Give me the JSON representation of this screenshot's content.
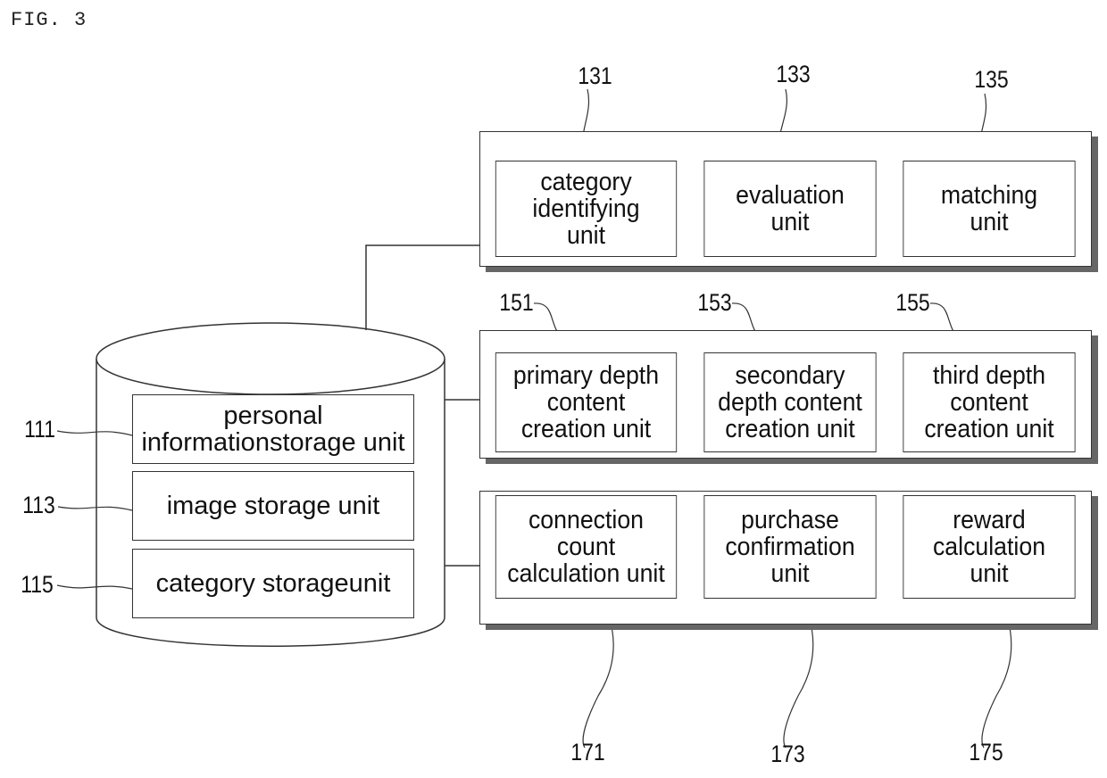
{
  "figure_label": "FIG. 3",
  "database": {
    "units": [
      {
        "ref": "111",
        "label_lines": [
          "personal information",
          "storage unit"
        ]
      },
      {
        "ref": "113",
        "label_lines": [
          "image storage unit"
        ]
      },
      {
        "ref": "115",
        "label_lines": [
          "category storage",
          "unit"
        ]
      }
    ]
  },
  "panels": [
    {
      "units": [
        {
          "ref": "131",
          "label_lines": [
            "category",
            "identifying",
            "unit"
          ]
        },
        {
          "ref": "133",
          "label_lines": [
            "evaluation",
            "unit"
          ]
        },
        {
          "ref": "135",
          "label_lines": [
            "matching",
            "unit"
          ]
        }
      ]
    },
    {
      "units": [
        {
          "ref": "151",
          "label_lines": [
            "primary depth",
            "content",
            "creation unit"
          ]
        },
        {
          "ref": "153",
          "label_lines": [
            "secondary",
            "depth content",
            "creation unit"
          ]
        },
        {
          "ref": "155",
          "label_lines": [
            "third depth",
            "content",
            "creation unit"
          ]
        }
      ]
    },
    {
      "units": [
        {
          "ref": "171",
          "label_lines": [
            "connection",
            "count",
            "calculation unit"
          ]
        },
        {
          "ref": "173",
          "label_lines": [
            "purchase",
            "confirmation",
            "unit"
          ]
        },
        {
          "ref": "175",
          "label_lines": [
            "reward",
            "calculation",
            "unit"
          ]
        }
      ]
    }
  ]
}
